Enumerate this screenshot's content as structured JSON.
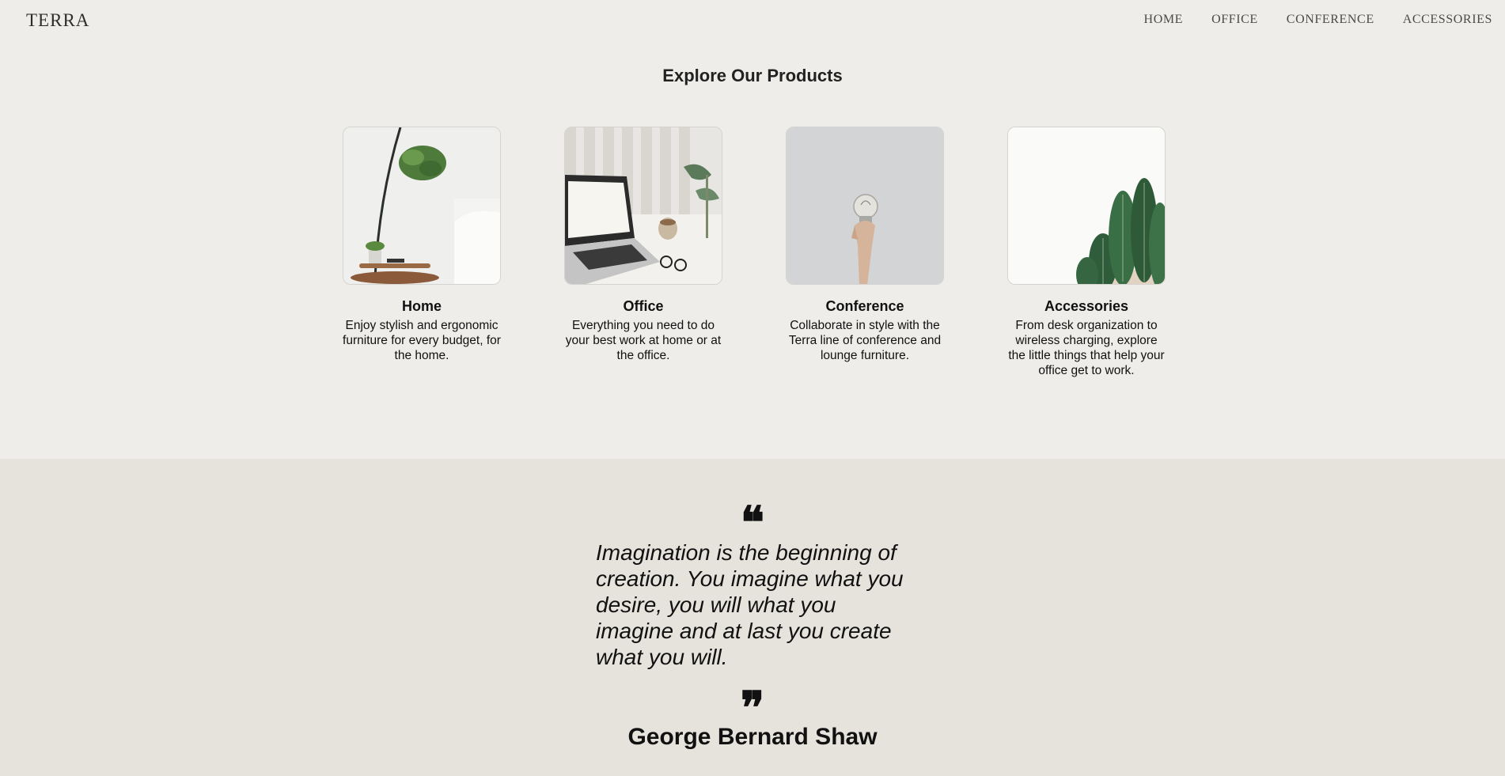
{
  "header": {
    "logo": "TERRA",
    "nav": [
      "HOME",
      "OFFICE",
      "CONFERENCE",
      "ACCESSORIES"
    ]
  },
  "products": {
    "title": "Explore Our Products",
    "items": [
      {
        "name": "Home",
        "description": "Enjoy stylish and ergonomic furniture for every budget, for the home.",
        "image": "plant-and-side-table-photo"
      },
      {
        "name": "Office",
        "description": "Everything you need to do your best work at home or at the office.",
        "image": "laptop-on-desk-photo"
      },
      {
        "name": "Conference",
        "description": "Collaborate in style with the Terra line of conference and lounge furniture.",
        "image": "hand-holding-bulb-photo"
      },
      {
        "name": "Accessories",
        "description": "From desk organization to wireless charging, explore the little things that help your office get to work.",
        "image": "cactus-photo"
      }
    ]
  },
  "quote": {
    "open_mark": "❝",
    "text": "Imagination is the beginning of creation. You imagine what you desire, you will what you imagine and at last you create what you will.",
    "close_mark": "❞",
    "author": "George Bernard Shaw"
  },
  "colors": {
    "page_background": "#eeede9",
    "quote_background": "#e6e3dd",
    "text": "#111111",
    "nav_text": "#4a4a4a"
  }
}
